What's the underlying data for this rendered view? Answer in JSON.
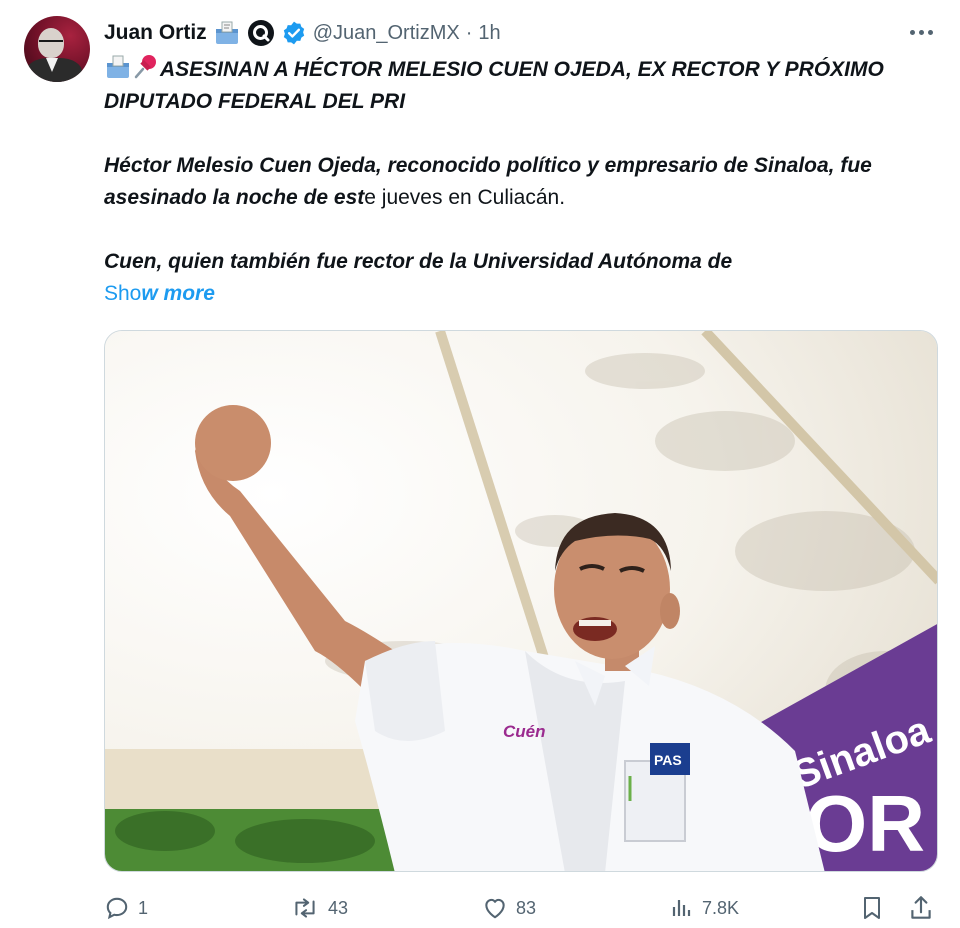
{
  "tweet": {
    "author": {
      "name": "Juan Ortiz",
      "handle": "@Juan_OrtizMX",
      "separator": "·",
      "time": "1h",
      "badges": [
        "ballot-box-emoji",
        "podcast-q-icon",
        "verified-badge-icon"
      ]
    },
    "text": {
      "headline": "ASESINAN A HÉCTOR MELESIO CUEN OJEDA, EX RECTOR Y PRÓXIMO DIPUTADO FEDERAL DEL PRI",
      "p2_bold": "Héctor Melesio Cuen Ojeda, reconocido político y empresario de Sinaloa, fue asesinado la noche de est",
      "p2_rest": "e jueves en Culiacán.",
      "p3_bold": "Cuen, quien también fue rector de la Universidad Autónoma de"
    },
    "show_more": {
      "plain": "Sho",
      "bold": "w more"
    },
    "media": {
      "shirt_logo_text": "Cuén",
      "badge_text": "PAS",
      "banner_text": "Sinaloa",
      "banner_big_text": "OR"
    },
    "actions": {
      "replies": "1",
      "reposts": "43",
      "likes": "83",
      "views": "7.8K"
    }
  },
  "colors": {
    "accent": "#1d9bf0",
    "secondary_text": "#536471",
    "banner_purple": "#6a3c93"
  }
}
